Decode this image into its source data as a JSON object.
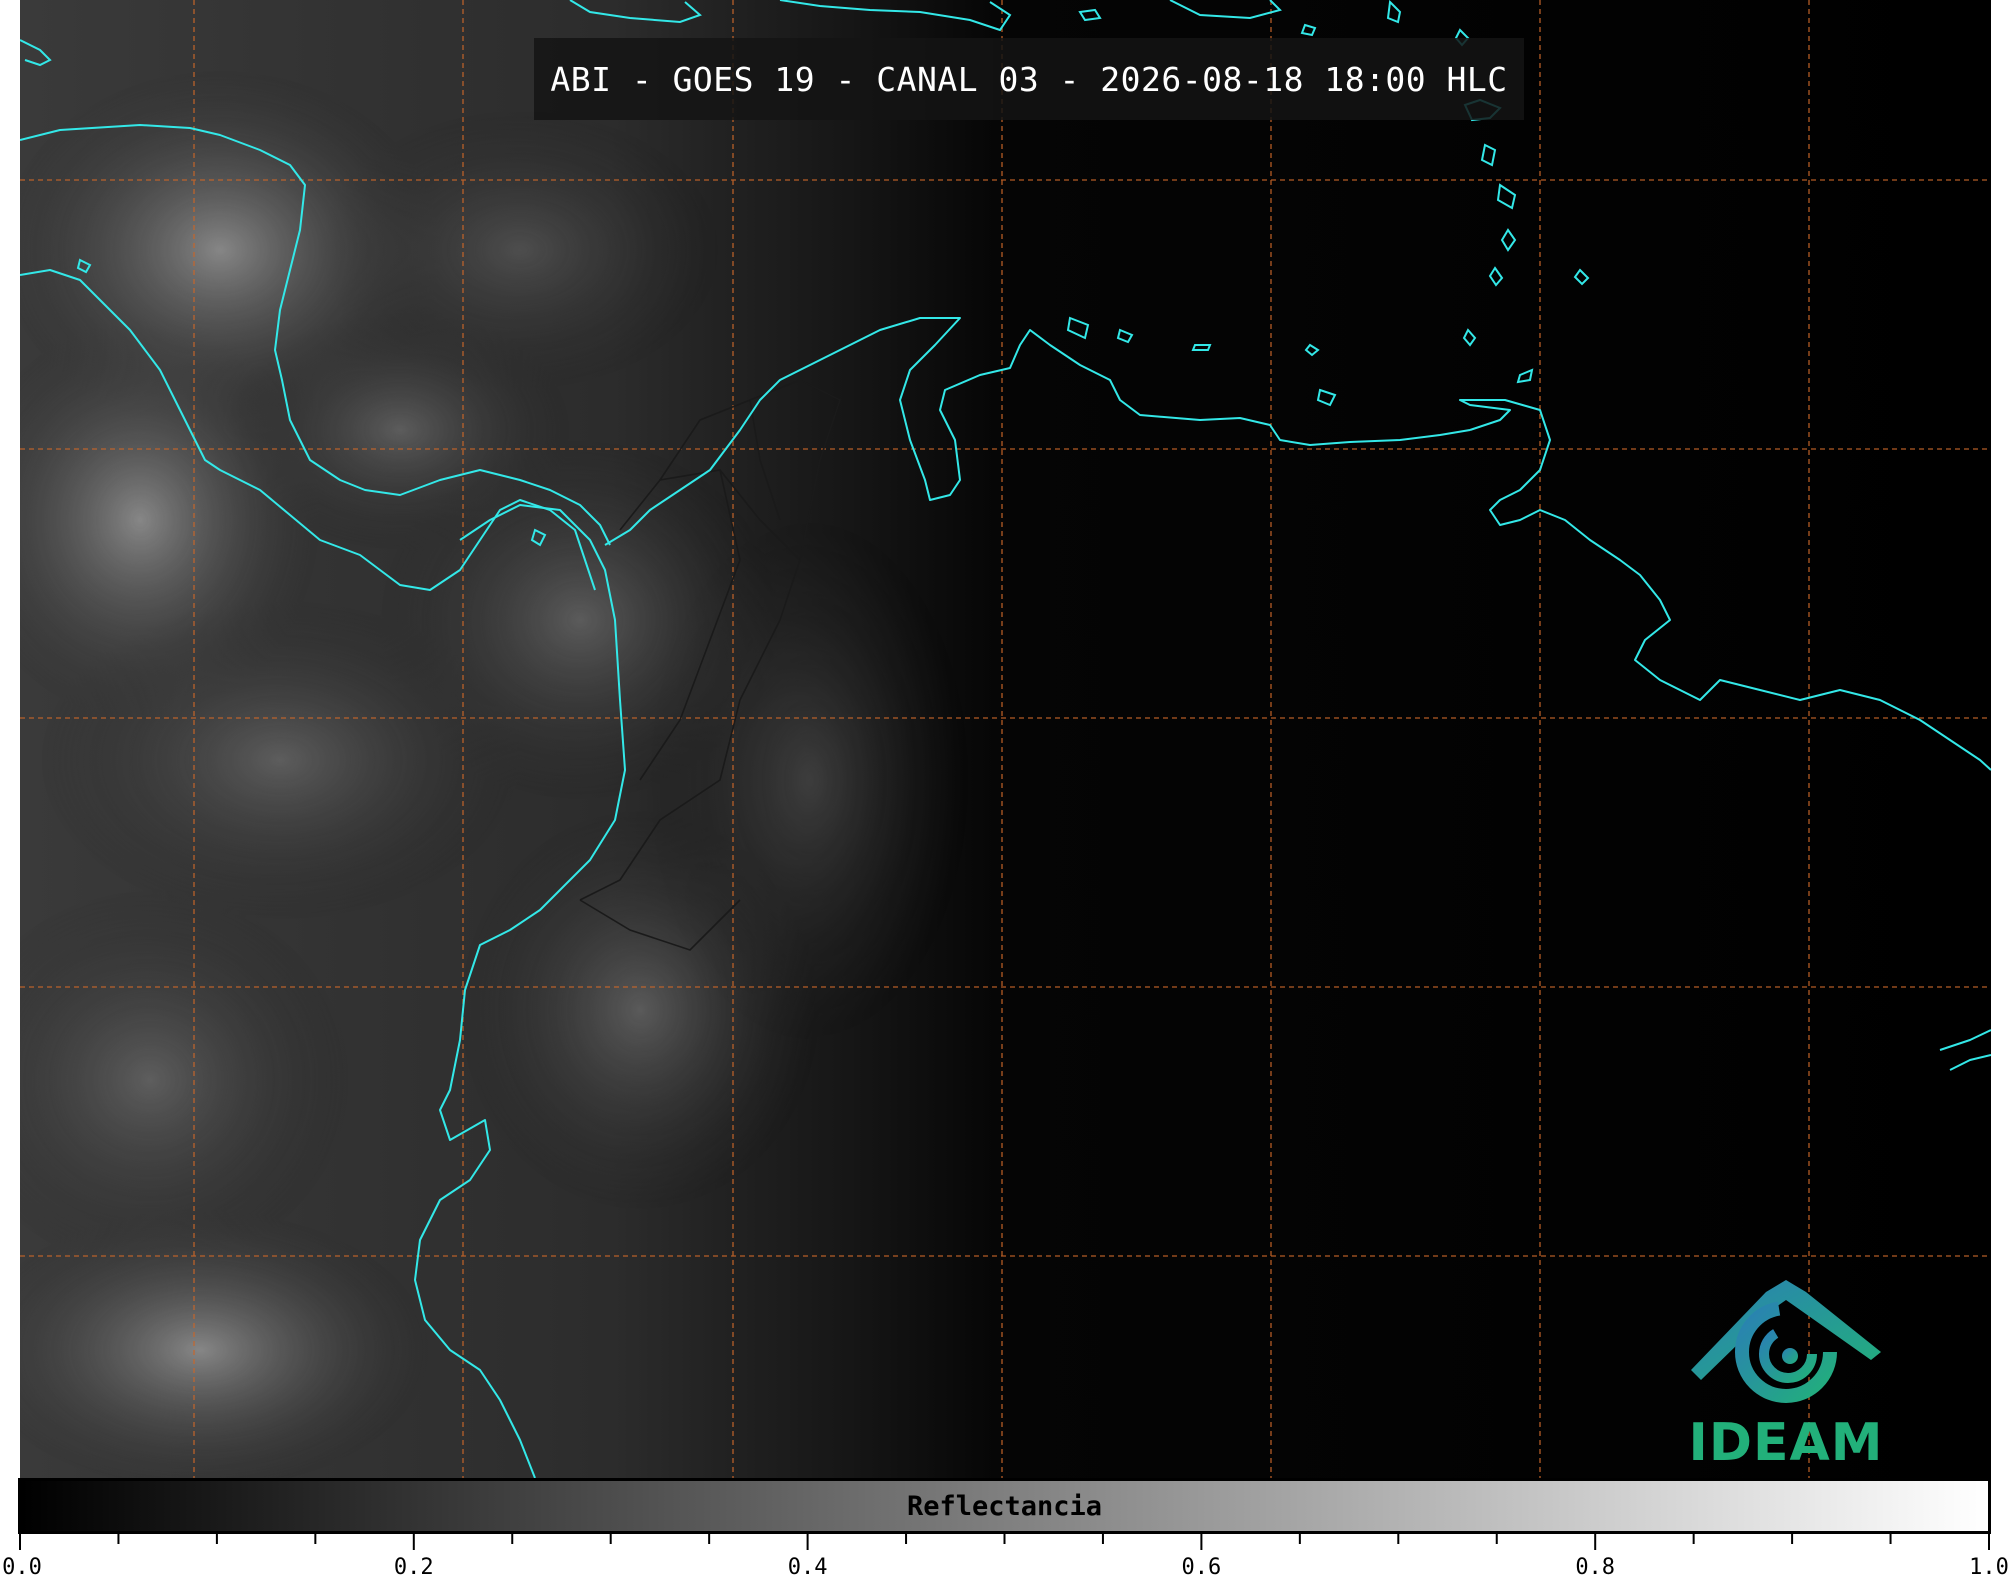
{
  "title": "ABI - GOES 19 - CANAL 03 - 2026-08-18 18:00 HLC",
  "logo": {
    "name": "ideam-logo",
    "text": "IDEAM",
    "color": "#22b07a",
    "arc_color": "#2a7fb5"
  },
  "colorbar": {
    "label": "Reflectancia",
    "min": 0.0,
    "max": 1.0,
    "ticks": [
      "0.0",
      "0.2",
      "0.4",
      "0.6",
      "0.8",
      "1.0"
    ],
    "minor_ticks_per_interval": 4,
    "colormap": [
      "#000000",
      "#ffffff"
    ]
  },
  "map": {
    "coastline_color": "#33e8e8",
    "gridline_color": "#c8662a",
    "border_color": "#1a1a1a",
    "background": "#000000"
  }
}
